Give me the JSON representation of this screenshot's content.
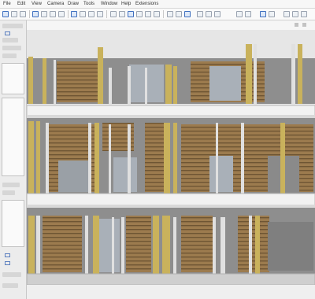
{
  "menu": {
    "items": [
      "File",
      "Edit",
      "View",
      "Camera",
      "Draw",
      "Tools",
      "Window",
      "Help",
      "Extensions"
    ]
  },
  "toolbar": {
    "buttons": [
      "select-icon",
      "eraser-icon",
      "paint-bucket-icon",
      "line-icon",
      "arc-icon",
      "rectangle-icon",
      "push-pull-icon",
      "move-icon",
      "rotate-icon",
      "scale-icon",
      "offset-icon",
      "tape-measure-icon",
      "text-icon",
      "orbit-icon",
      "pan-icon",
      "zoom-icon",
      "zoom-extents-icon",
      "section-plane-icon",
      "component-icon",
      "layer-icon"
    ]
  },
  "viewport": {
    "scene_name": "",
    "colors": {
      "slab": "#f2f2f2",
      "slab_edge": "#b8b8b8",
      "wood": "#9c7b4e",
      "wood_stripe": "#6e5533",
      "concrete": "#8f8f8f",
      "post": "#c9b25c",
      "column": "#d8d8d8",
      "glass": "#a9b0b8",
      "background": "#eaeaea"
    }
  }
}
